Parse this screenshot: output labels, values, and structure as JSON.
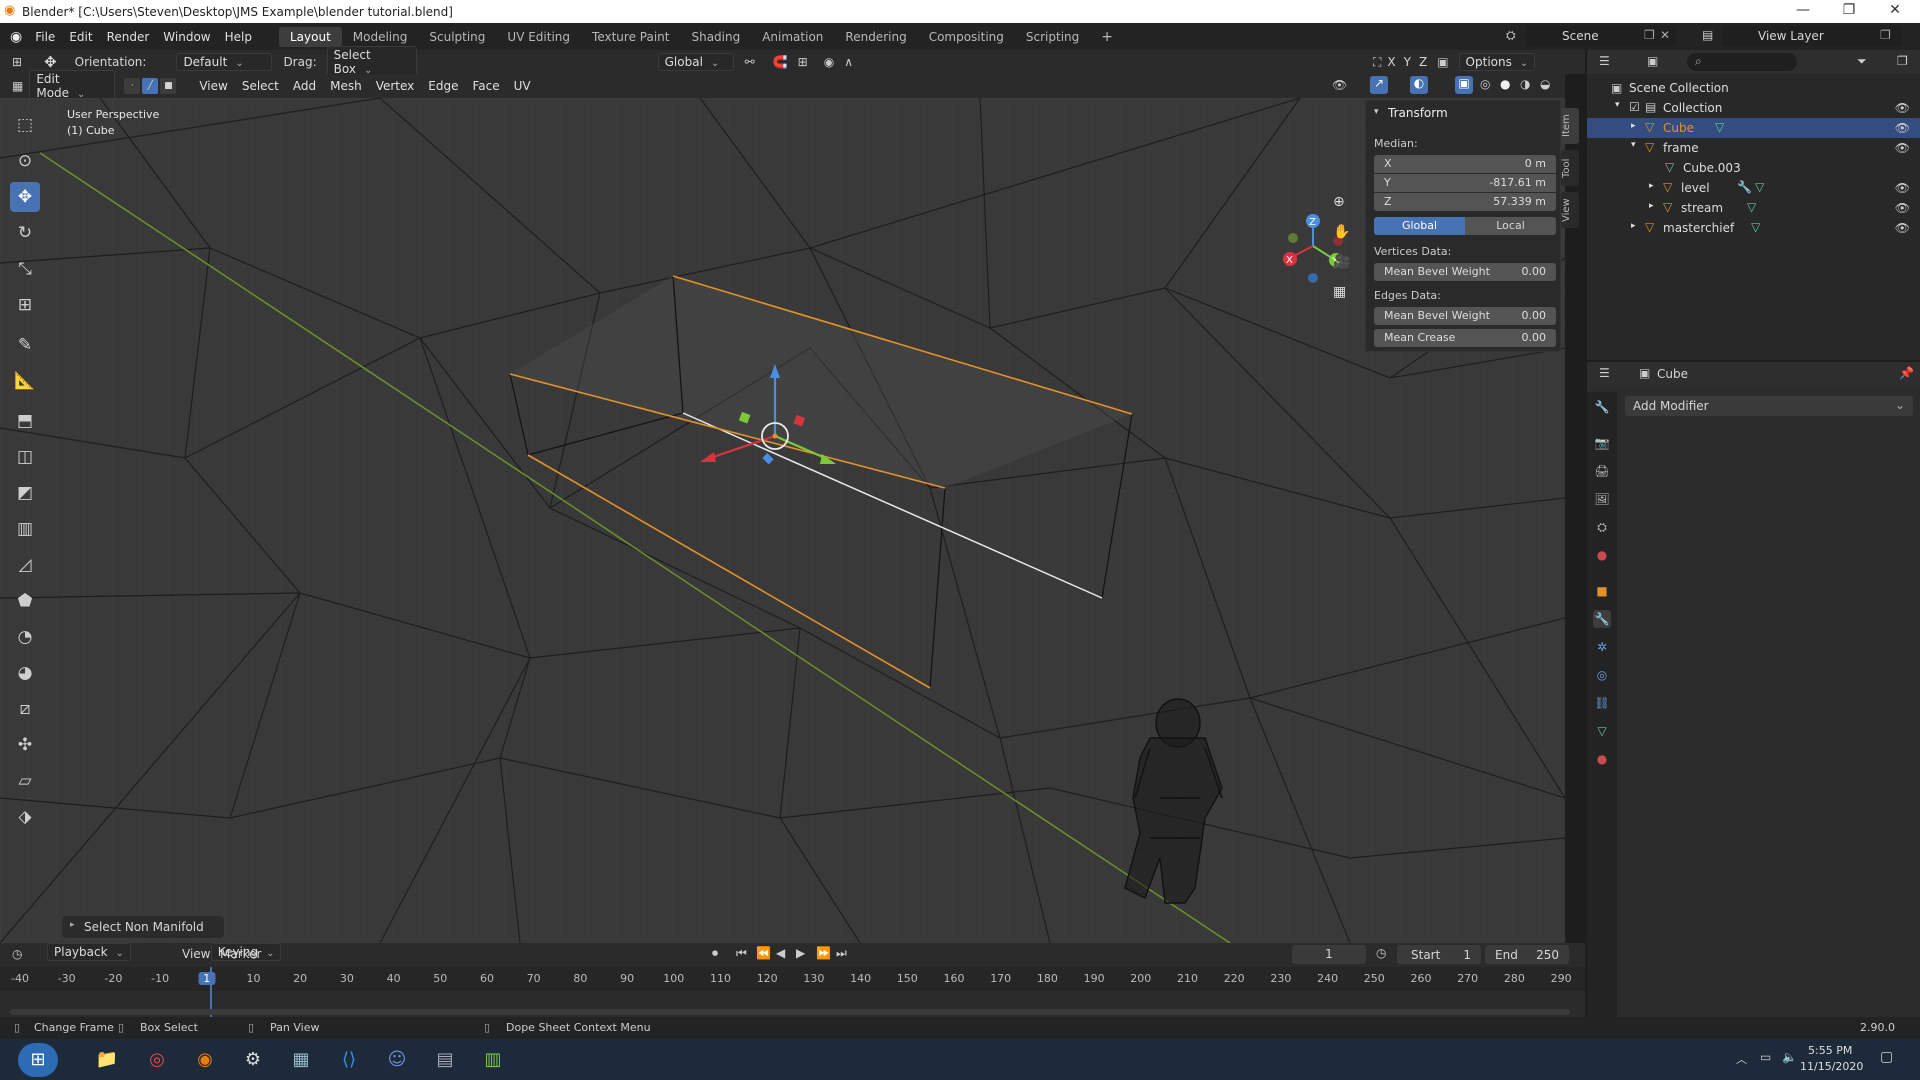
{
  "window": {
    "title": "Blender* [C:\\Users\\Steven\\Desktop\\JMS Example\\blender tutorial.blend]",
    "min": "—",
    "max": "❐",
    "close": "✕"
  },
  "menus": [
    "File",
    "Edit",
    "Render",
    "Window",
    "Help"
  ],
  "workspaces": [
    "Layout",
    "Modeling",
    "Sculpting",
    "UV Editing",
    "Texture Paint",
    "Shading",
    "Animation",
    "Rendering",
    "Compositing",
    "Scripting"
  ],
  "scene": {
    "label": "Scene",
    "view_layer": "View Layer"
  },
  "tool_header": {
    "orientation_label": "Orientation:",
    "orientation_value": "Default",
    "drag_label": "Drag:",
    "drag_value": "Select Box",
    "transform": "Global",
    "options": "Options",
    "axes": [
      "X",
      "Y",
      "Z"
    ]
  },
  "mode_header": {
    "mode": "Edit Mode",
    "items": [
      "View",
      "Select",
      "Add",
      "Mesh",
      "Vertex",
      "Edge",
      "Face",
      "UV"
    ]
  },
  "viewport": {
    "overlay_line1": "User Perspective",
    "overlay_line2": "(1) Cube",
    "last_op": "Select Non Manifold"
  },
  "npanel": {
    "title": "Transform",
    "median": "Median:",
    "x_label": "X",
    "x": "0 m",
    "y_label": "Y",
    "y": "-817.61 m",
    "z_label": "Z",
    "z": "57.339 m",
    "global": "Global",
    "local": "Local",
    "vertices_data": "Vertices Data:",
    "v_bevel_label": "Mean Bevel Weight",
    "v_bevel": "0.00",
    "edges_data": "Edges Data:",
    "e_bevel_label": "Mean Bevel Weight",
    "e_bevel": "0.00",
    "crease_label": "Mean Crease",
    "crease": "0.00",
    "tabs": [
      "Item",
      "Tool",
      "View"
    ]
  },
  "outliner": {
    "root": "Scene Collection",
    "collection": "Collection",
    "items": [
      "Cube",
      "frame",
      "Cube.003",
      "level",
      "stream",
      "masterchief"
    ]
  },
  "properties": {
    "object": "Cube",
    "add_modifier": "Add Modifier"
  },
  "timeline": {
    "menus": [
      "Playback",
      "Keying",
      "View",
      "Marker"
    ],
    "current": "1",
    "start_label": "Start",
    "start": "1",
    "end_label": "End",
    "end": "250",
    "ruler": [
      "-40",
      "-30",
      "-20",
      "-10",
      "1",
      "10",
      "20",
      "30",
      "40",
      "50",
      "60",
      "70",
      "80",
      "90",
      "100",
      "110",
      "120",
      "130",
      "140",
      "150",
      "160",
      "170",
      "180",
      "190",
      "200",
      "210",
      "220",
      "230",
      "240",
      "250",
      "260",
      "270",
      "280",
      "290"
    ]
  },
  "status": {
    "change_frame": "Change Frame",
    "box_select": "Box Select",
    "pan_view": "Pan View",
    "context": "Dope Sheet Context Menu",
    "version": "2.90.0"
  },
  "taskbar": {
    "time": "5:55 PM",
    "date": "11/15/2020"
  },
  "colors": {
    "accent": "#4772b3",
    "selected_edge": "#e3922a",
    "bg": "#393939"
  }
}
